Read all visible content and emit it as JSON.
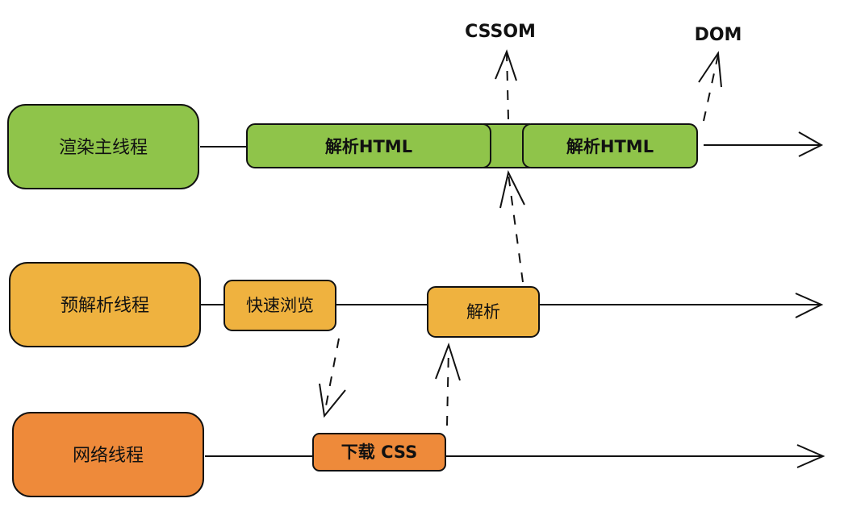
{
  "threads": {
    "render": {
      "label": "渲染主线程",
      "fill": "#8fc44a"
    },
    "preparse": {
      "label": "预解析线程",
      "fill": "#efb23f"
    },
    "network": {
      "label": "网络线程",
      "fill": "#ee8a3a"
    }
  },
  "tasks": {
    "parse_html_1": "解析HTML",
    "parse_html_2": "解析HTML",
    "quick_browse": "快速浏览",
    "parse": "解析",
    "download_css": "下载 CSS"
  },
  "outputs": {
    "cssom": "CSSOM",
    "dom": "DOM"
  },
  "colors": {
    "stroke": "#111111",
    "green": "#8fc44a",
    "yellow": "#efb23f",
    "orange": "#ee8a3a"
  }
}
